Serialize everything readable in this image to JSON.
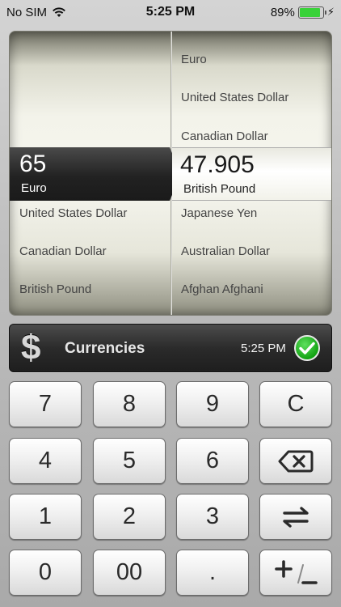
{
  "status": {
    "carrier": "No SIM",
    "time": "5:25 PM",
    "battery_text": "89%",
    "battery_level": 0.89,
    "battery_color": "#38d238"
  },
  "picker": {
    "left": {
      "above": [],
      "selected_amount": "65",
      "selected_currency": "Euro",
      "below": [
        "United States Dollar",
        "Canadian Dollar",
        "British Pound"
      ]
    },
    "right": {
      "above": [
        "Euro",
        "United States Dollar",
        "Canadian Dollar"
      ],
      "selected_amount": "47.905",
      "selected_currency": "British Pound",
      "below": [
        "Japanese Yen",
        "Australian Dollar",
        "Afghan Afghani"
      ]
    }
  },
  "category": {
    "icon": "dollar-sign-icon",
    "label": "Currencies",
    "updated_time": "5:25 PM",
    "status_icon": "check-icon",
    "status_color": "#14a314"
  },
  "keypad": {
    "rows": [
      [
        "7",
        "8",
        "9",
        "C"
      ],
      [
        "4",
        "5",
        "6",
        "backspace"
      ],
      [
        "1",
        "2",
        "3",
        "swap"
      ],
      [
        "0",
        "00",
        ".",
        "plus-minus"
      ]
    ],
    "labels": {
      "k7": "7",
      "k8": "8",
      "k9": "9",
      "clear": "C",
      "k4": "4",
      "k5": "5",
      "k6": "6",
      "k1": "1",
      "k2": "2",
      "k3": "3",
      "k0": "0",
      "k00": "00",
      "decimal": "."
    }
  }
}
